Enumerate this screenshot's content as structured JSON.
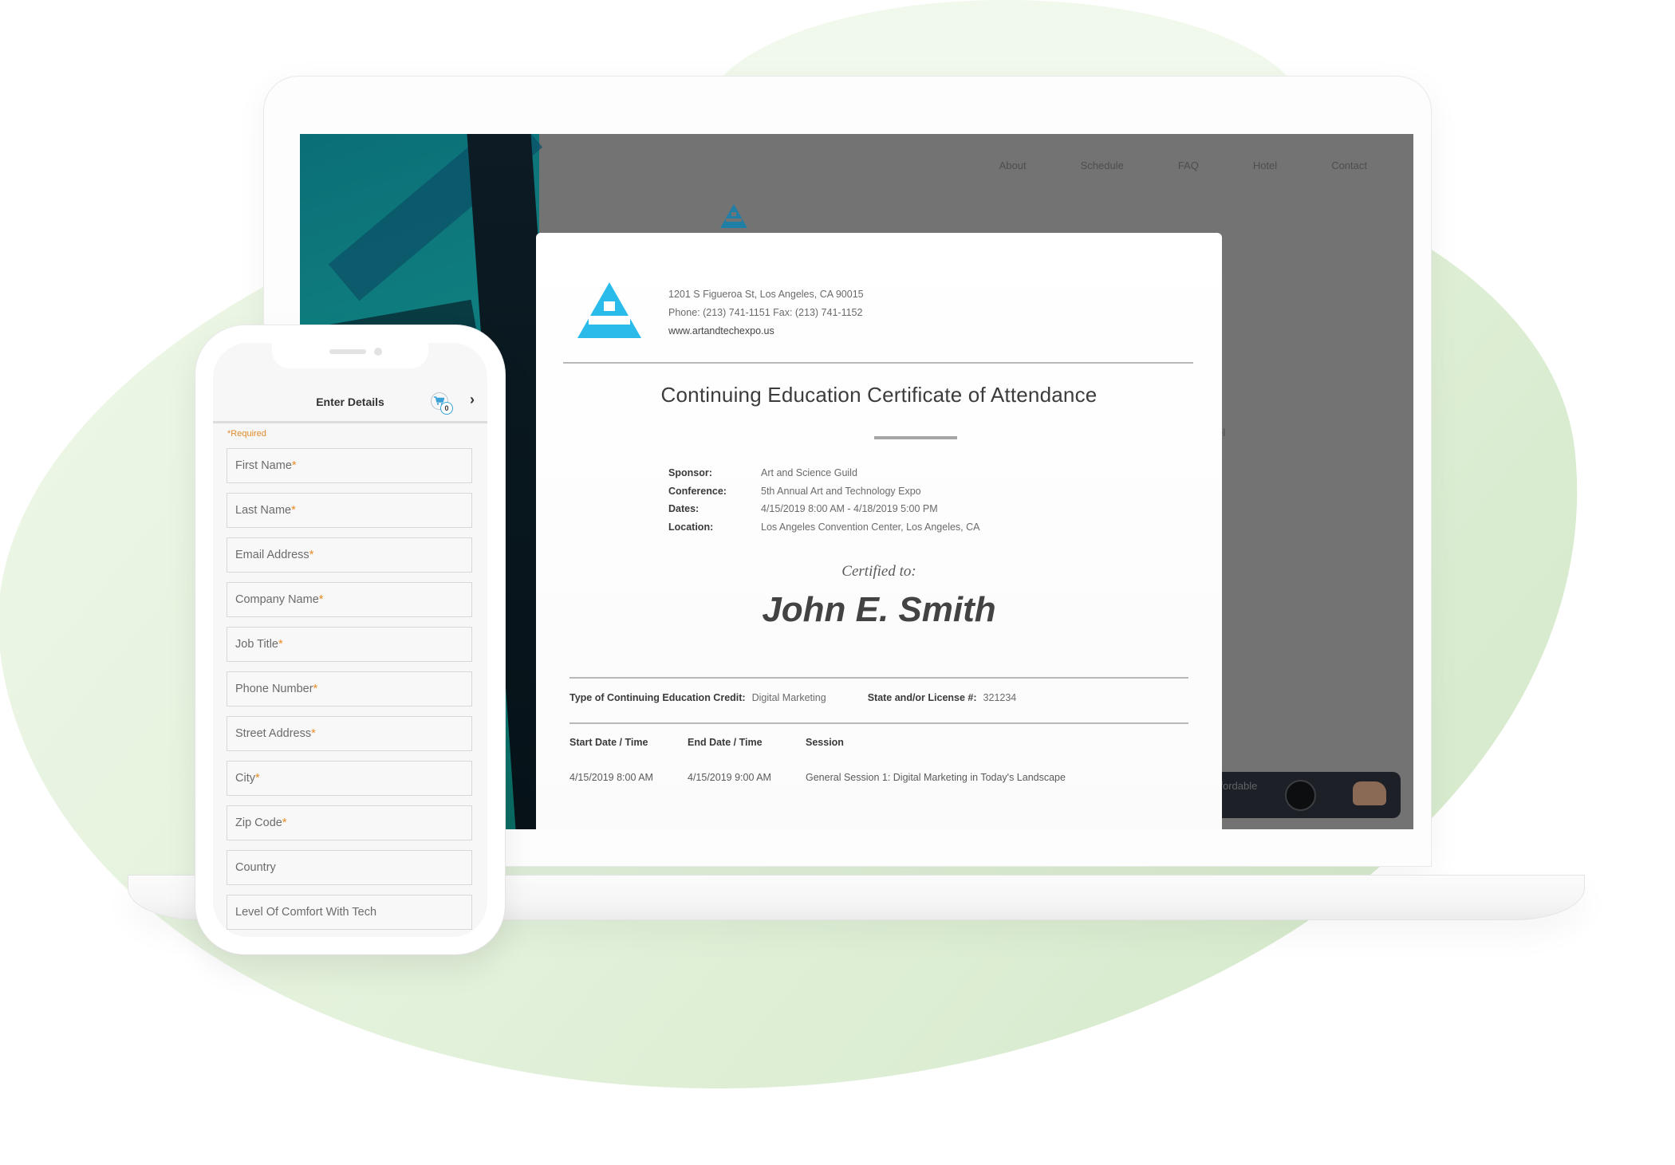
{
  "website": {
    "nav": [
      "About",
      "Schedule",
      "FAQ",
      "Hotel",
      "Contact"
    ],
    "partial_side_text": "el",
    "promo_partial_text": "ffordable",
    "brand_color": "#2bb6e6"
  },
  "certificate": {
    "contact": {
      "address": "1201 S Figueroa St, Los Angeles, CA 90015",
      "phone_fax": "Phone: (213) 741-1151  Fax: (213) 741-1152",
      "website": "www.artandtechexpo.us"
    },
    "title": "Continuing Education Certificate of Attendance",
    "details": [
      {
        "label": "Sponsor:",
        "value": "Art and Science Guild"
      },
      {
        "label": "Conference:",
        "value": "5th Annual Art and Technology Expo"
      },
      {
        "label": "Dates:",
        "value": "4/15/2019  8:00 AM - 4/18/2019 5:00 PM"
      },
      {
        "label": "Location:",
        "value": "Los Angeles Convention Center, Los Angeles, CA"
      }
    ],
    "certified_to_label": "Certified to:",
    "recipient_name": "John E. Smith",
    "credit_type_label": "Type of Continuing Education Credit:",
    "credit_type_value": "Digital Marketing",
    "license_label": "State and/or License #:",
    "license_value": "321234",
    "table": {
      "headers": [
        "Start Date / Time",
        "End Date / Time",
        "Session"
      ],
      "rows": [
        [
          "4/15/2019 8:00 AM",
          "4/15/2019 9:00 AM",
          "General Session 1: Digital Marketing in Today's Landscape"
        ]
      ]
    }
  },
  "phone": {
    "header_title": "Enter Details",
    "cart_count": "0",
    "next_glyph": "›",
    "required_note": "*Required",
    "required_color": "#e98b24",
    "fields": [
      {
        "label": "First Name",
        "required": "*"
      },
      {
        "label": "Last Name",
        "required": "*"
      },
      {
        "label": "Email Address",
        "required": "*"
      },
      {
        "label": "Company Name",
        "required": "*"
      },
      {
        "label": "Job Title",
        "required": "*"
      },
      {
        "label": "Phone Number",
        "required": "*"
      },
      {
        "label": "Street Address",
        "required": "*"
      },
      {
        "label": "City",
        "required": "*"
      },
      {
        "label": "Zip Code",
        "required": "*"
      },
      {
        "label": "Country",
        "required": ""
      },
      {
        "label": "Level Of Comfort With Tech",
        "required": ""
      }
    ]
  }
}
